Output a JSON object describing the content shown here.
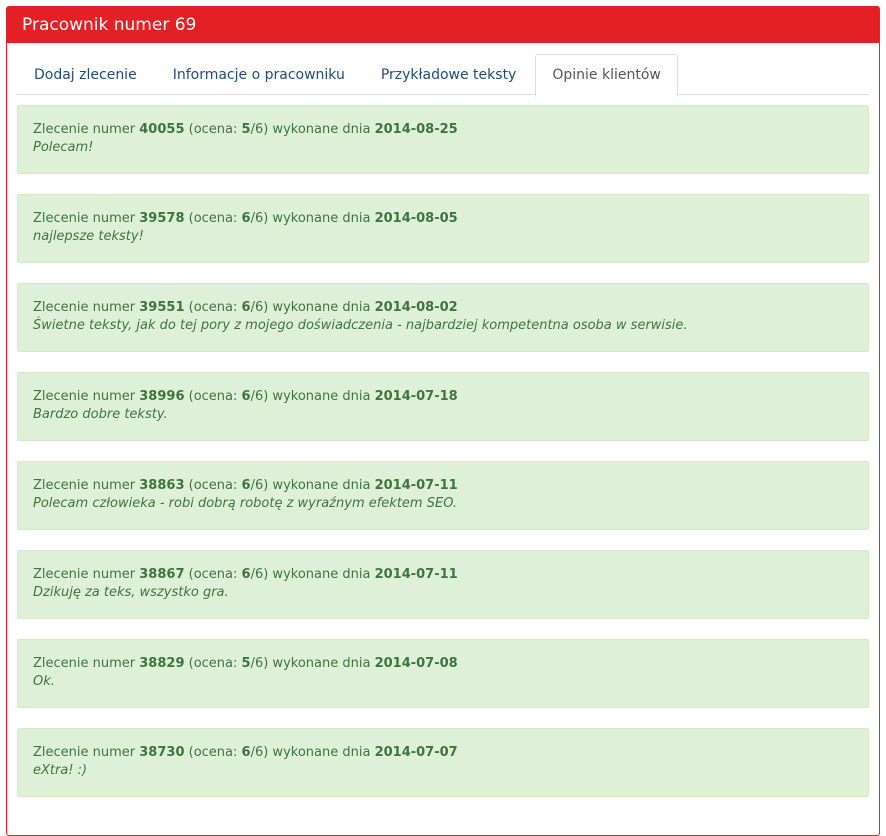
{
  "panel": {
    "title": "Pracownik numer 69"
  },
  "tabs": [
    {
      "label": "Dodaj zlecenie"
    },
    {
      "label": "Informacje o pracowniku"
    },
    {
      "label": "Przykładowe teksty"
    },
    {
      "label": "Opinie klientów"
    }
  ],
  "active_tab": "Opinie klientów",
  "opinion_text": {
    "prefix": "Zlecenie numer ",
    "rating_open": " (ocena: ",
    "rating_close": "/6) wykonane dnia "
  },
  "opinions": [
    {
      "number": "40055",
      "rating": "5",
      "date": "2014-08-25",
      "comment": "Polecam!"
    },
    {
      "number": "39578",
      "rating": "6",
      "date": "2014-08-05",
      "comment": "najlepsze teksty!"
    },
    {
      "number": "39551",
      "rating": "6",
      "date": "2014-08-02",
      "comment": "Świetne teksty, jak do tej pory z mojego doświadczenia - najbardziej kompetentna osoba w serwisie."
    },
    {
      "number": "38996",
      "rating": "6",
      "date": "2014-07-18",
      "comment": "Bardzo dobre teksty."
    },
    {
      "number": "38863",
      "rating": "6",
      "date": "2014-07-11",
      "comment": "Polecam człowieka - robi dobrą robotę z wyraźnym efektem SEO."
    },
    {
      "number": "38867",
      "rating": "6",
      "date": "2014-07-11",
      "comment": "Dzikuję za teks, wszystko gra."
    },
    {
      "number": "38829",
      "rating": "5",
      "date": "2014-07-08",
      "comment": "Ok."
    },
    {
      "number": "38730",
      "rating": "6",
      "date": "2014-07-07",
      "comment": "eXtra! :)"
    }
  ],
  "colors": {
    "header_bg": "#e32124",
    "opinion_bg": "#dff0d8",
    "opinion_text": "#3c763d",
    "tab_link": "#1f4e73"
  }
}
